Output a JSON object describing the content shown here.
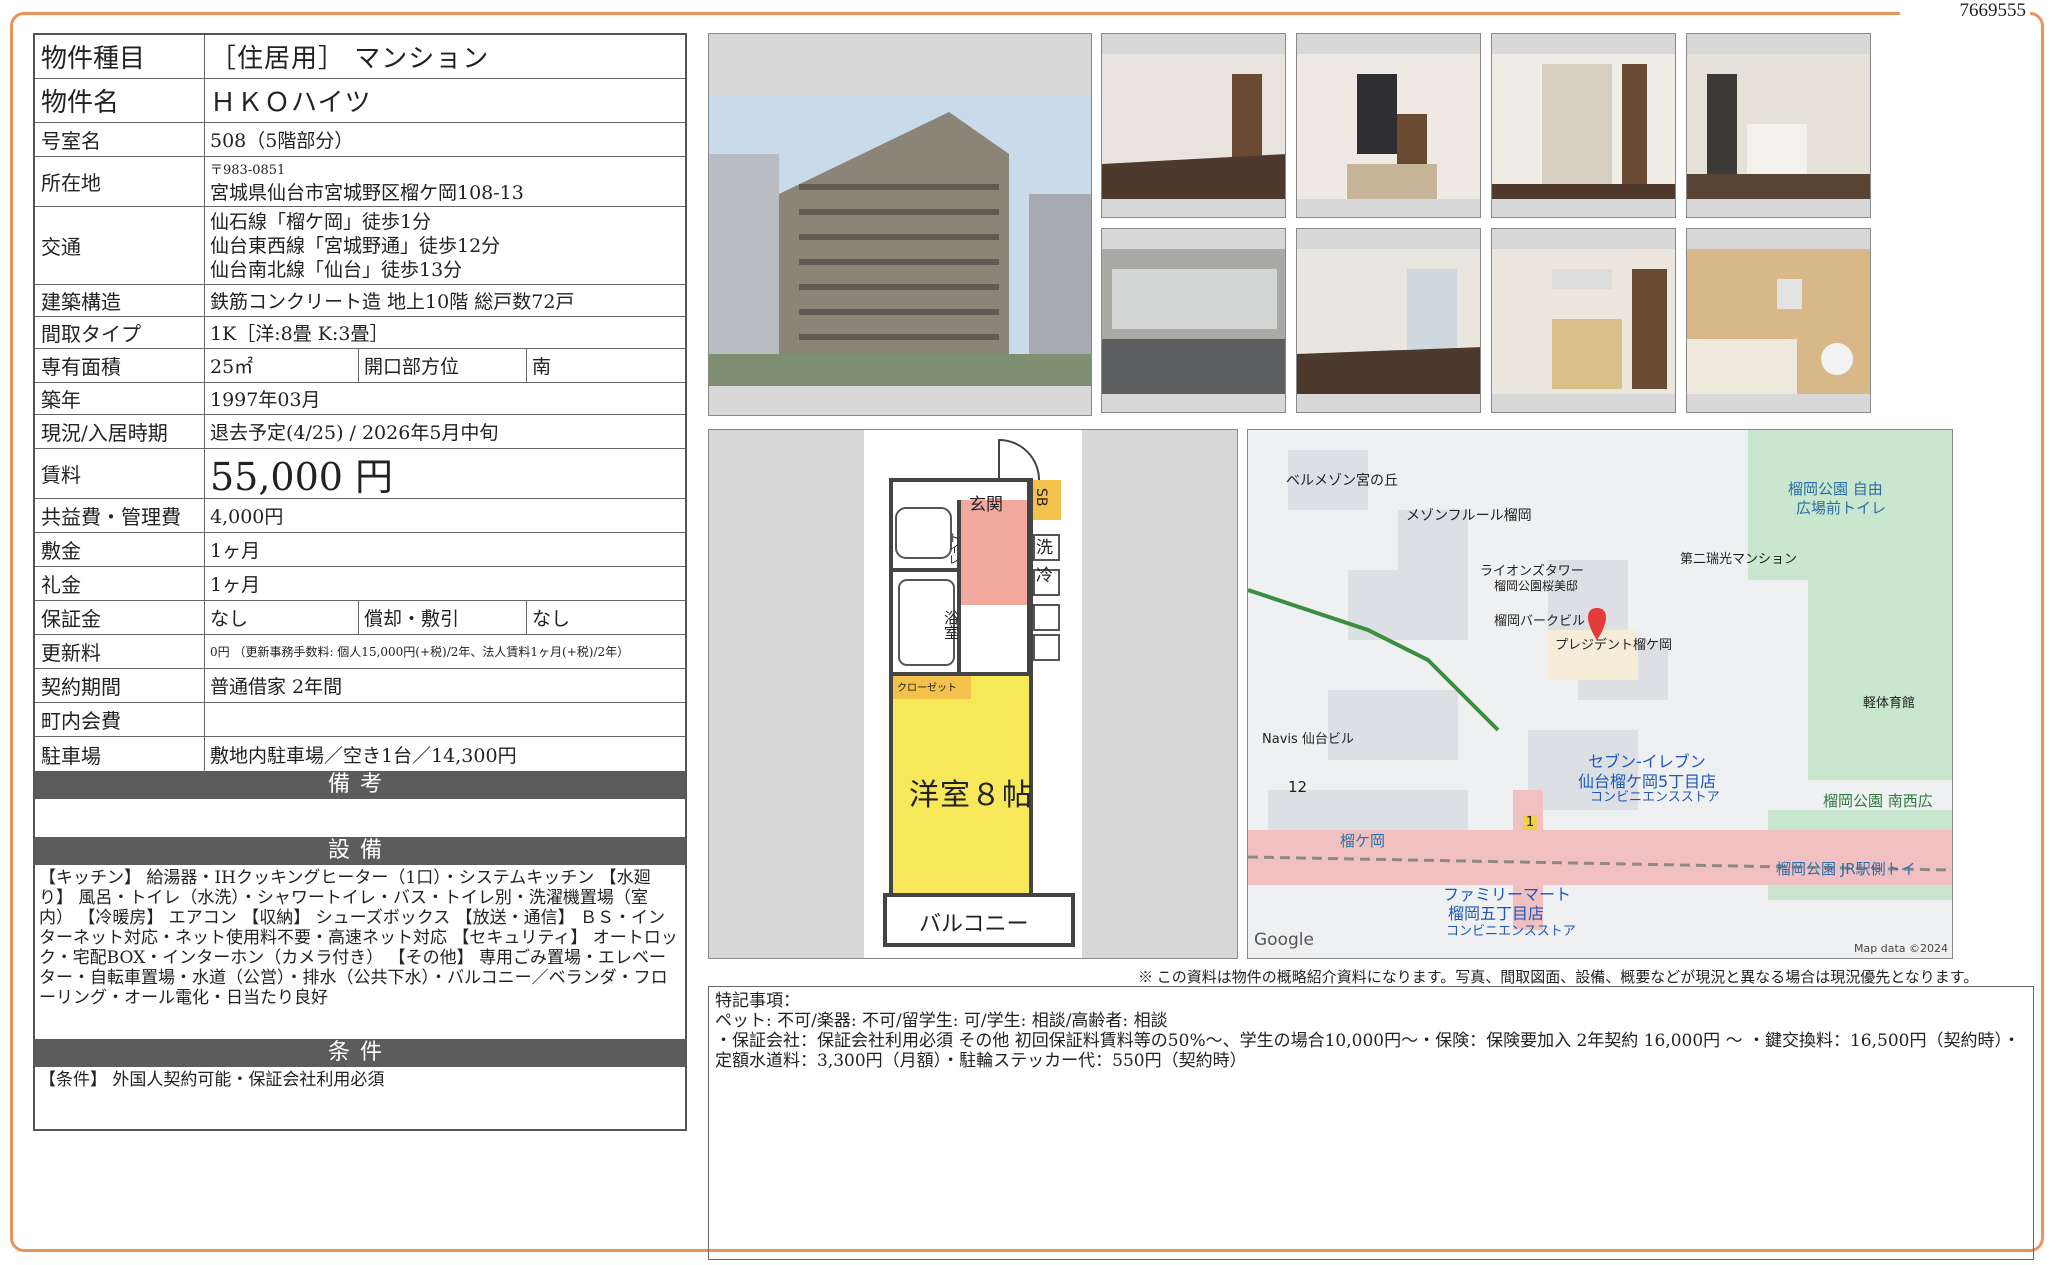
{
  "doc_id": "7669555",
  "spec": {
    "type_label": "物件種目",
    "type_value": "［住居用］ マンション",
    "name_label": "物件名",
    "name_value": "ＨＫＯハイツ",
    "room_label": "号室名",
    "room_value": "508（5階部分）",
    "addr_label": "所在地",
    "addr_zip": "〒983-0851",
    "addr_value": "宮城県仙台市宮城野区榴ケ岡108-13",
    "transit_label": "交通",
    "transit_lines": [
      "仙石線「榴ケ岡」徒歩1分",
      "仙台東西線「宮城野通」徒歩12分",
      "仙台南北線「仙台」徒歩13分"
    ],
    "struct_label": "建築構造",
    "struct_value": "鉄筋コンクリート造 地上10階 総戸数72戸",
    "layout_label": "間取タイプ",
    "layout_value": "1K［洋:8畳 K:3畳］",
    "area_label": "専有面積",
    "area_value": "25㎡",
    "dir_label": "開口部方位",
    "dir_value": "南",
    "built_label": "築年",
    "built_value": "1997年03月",
    "status_label": "現況/入居時期",
    "status_value": "退去予定(4/25)  /  2026年5月中旬",
    "rent_label": "賃料",
    "rent_value": "55,000 円",
    "fee_label": "共益費・管理費",
    "fee_value": "4,000円",
    "deposit_label": "敷金",
    "deposit_value": "1ヶ月",
    "keymoney_label": "礼金",
    "keymoney_value": "1ヶ月",
    "guarantee_label": "保証金",
    "guarantee_value": "なし",
    "amort_label": "償却・敷引",
    "amort_value": "なし",
    "renew_label": "更新料",
    "renew_value": "0円 （更新事務手数料: 個人15,000円(+税)/2年、法人賃料1ヶ月(+税)/2年）",
    "contract_label": "契約期間",
    "contract_value": "普通借家 2年間",
    "town_label": "町内会費",
    "town_value": "",
    "parking_label": "駐車場",
    "parking_value": "敷地内駐車場／空き1台／14,300円"
  },
  "remarks_header": "備考",
  "remarks_text": "",
  "equip_header": "設備",
  "equip_text": "【キッチン】 給湯器・IHクッキングヒーター（1口）・システムキッチン 【水廻り】 風呂・トイレ（水洗）・シャワートイレ・バス・トイレ別・洗濯機置場（室内） 【冷暖房】 エアコン 【収納】 シューズボックス 【放送・通信】 ＢＳ・インターネット対応・ネット使用料不要・高速ネット対応 【セキュリティ】 オートロック・宅配BOX・インターホン（カメラ付き） 【その他】 専用ごみ置場・エレベーター・自転車置場・水道（公営）・排水（公共下水）・バルコニー／ベランダ・フローリング・オール電化・日当たり良好",
  "cond_header": "条件",
  "cond_text": "【条件】 外国人契約可能・保証会社利用必須",
  "floorplan": {
    "entrance": "玄関",
    "sb": "SB",
    "wash": "洗",
    "fridge": "冷",
    "toilet": "トイレ",
    "bath": "浴室",
    "closet": "クローゼット",
    "room": "洋室８帖",
    "balcony": "バルコニー"
  },
  "map": {
    "labels": [
      "ベルメゾン宮の丘",
      "メゾンフルール榴岡",
      "ライオンズタワー",
      "榴岡公園桜美邸",
      "第二瑞光マンション",
      "榴岡バークビル",
      "プレジデント榴ケ岡",
      "軽体育館",
      "Navis 仙台ビル",
      "12",
      "セブン-イレブン",
      "仙台榴ケ岡5丁目店",
      "コンビニエンスストア",
      "榴岡公園 自由",
      "広場前トイレ",
      "榴岡公園 南西広",
      "榴岡公園 JR駅側トイ",
      "榴ケ岡",
      "ファミリーマート",
      "榴岡五丁目店",
      "コンビニエンスストア",
      "1",
      "Google",
      "Map data ©2024"
    ]
  },
  "note": "※ この資料は物件の概略紹介資料になります。写真、間取図面、設備、概要などが現況と異なる場合は現況優先となります。",
  "special": {
    "title": "特記事項：",
    "lines": [
      "ペット: 不可/楽器: 不可/留学生: 可/学生: 相談/高齢者: 相談",
      "・保証会社：保証会社利用必須 その他 初回保証料賃料等の50%～、学生の場合10,000円～・保険：保険要加入 2年契約 16,000円 ～ ・鍵交換料：16,500円（契約時）・定額水道料：3,300円（月額）・駐輪ステッカー代：550円（契約時）"
    ]
  },
  "colors": {
    "frame": "#e8935a",
    "header_bg": "#5c5c5c",
    "room_yellow": "#f7e85a",
    "hall_pink": "#f2a9a0"
  }
}
